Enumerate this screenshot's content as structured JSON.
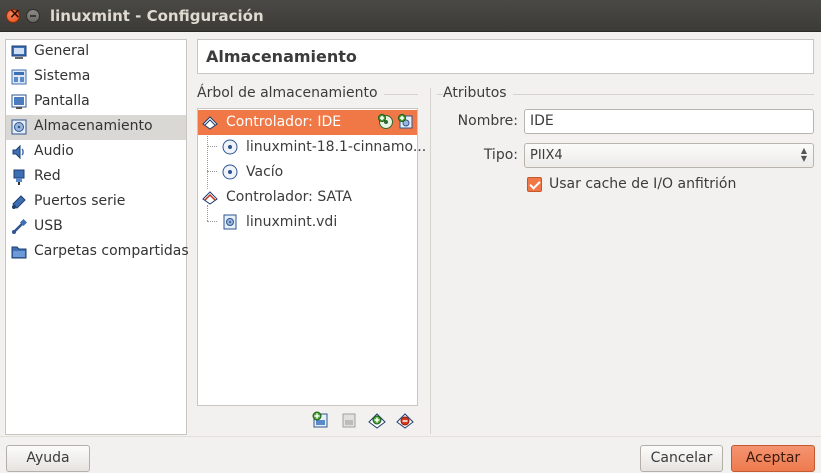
{
  "window": {
    "title": "linuxmint - Configuración"
  },
  "sidebar": {
    "items": [
      {
        "label": "General",
        "icon": "general-icon",
        "selected": false
      },
      {
        "label": "Sistema",
        "icon": "system-icon",
        "selected": false
      },
      {
        "label": "Pantalla",
        "icon": "display-icon",
        "selected": false
      },
      {
        "label": "Almacenamiento",
        "icon": "storage-icon",
        "selected": true
      },
      {
        "label": "Audio",
        "icon": "audio-icon",
        "selected": false
      },
      {
        "label": "Red",
        "icon": "network-icon",
        "selected": false
      },
      {
        "label": "Puertos serie",
        "icon": "serial-port-icon",
        "selected": false
      },
      {
        "label": "USB",
        "icon": "usb-icon",
        "selected": false
      },
      {
        "label": "Carpetas compartidas",
        "icon": "shared-folder-icon",
        "selected": false
      }
    ]
  },
  "header": {
    "title": "Almacenamiento"
  },
  "tree": {
    "section_label": "Árbol de almacenamiento",
    "controller_ide": "Controlador: IDE",
    "ide_disc1": "linuxmint-18.1-cinnamo...",
    "ide_disc2": "Vacío",
    "controller_sata": "Controlador: SATA",
    "sata_disk1": "linuxmint.vdi"
  },
  "attributes": {
    "section_label": "Atributos",
    "name_label": "Nombre:",
    "name_value": "IDE",
    "type_label": "Tipo:",
    "type_value": "PIIX4",
    "cache_label": "Usar cache de I/O anfitrión",
    "cache_checked": true
  },
  "buttons": {
    "help": "Ayuda",
    "cancel": "Cancelar",
    "accept": "Aceptar"
  },
  "colors": {
    "accent": "#f07746",
    "titlebar": "#3c3b37",
    "background": "#f2f1f0"
  }
}
